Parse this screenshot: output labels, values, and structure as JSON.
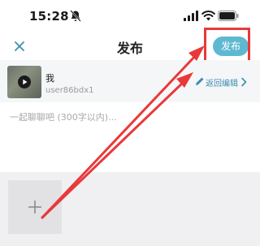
{
  "status_bar": {
    "time": "15:28",
    "icons": [
      "bell-muted-icon",
      "signal-icon",
      "wifi-icon",
      "battery-icon"
    ]
  },
  "nav": {
    "close_icon": "close-icon",
    "title": "发布",
    "publish_label": "发布"
  },
  "post": {
    "name": "我",
    "user": "user86bdx1",
    "edit_label": "返回编辑",
    "thumb_icon": "play-icon"
  },
  "input": {
    "placeholder": "一起聊聊吧 (300字以内)..."
  },
  "media": {
    "add_icon": "plus-icon"
  },
  "colors": {
    "accent": "#5fb8d1",
    "link": "#3a8fb0",
    "annotation": "#e8393a",
    "card_bg": "#f5f6f8",
    "bottom_bg": "#f0f0f2"
  }
}
